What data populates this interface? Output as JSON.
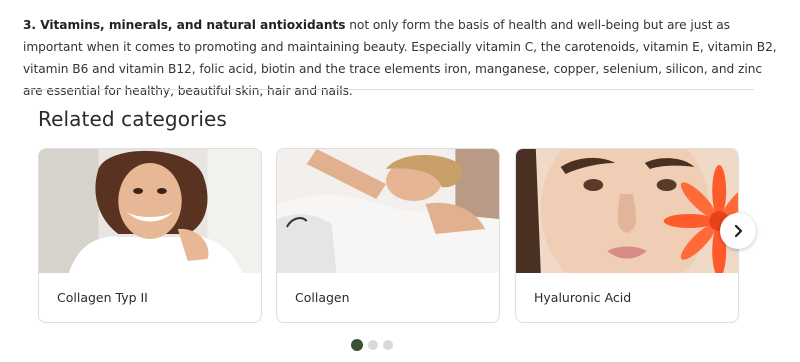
{
  "article": {
    "bold_lead": "3. Vitamins, minerals, and natural antioxidants",
    "body": " not only form the basis of health and well-being but are just as important when it comes to promoting and maintaining beauty. Especially vitamin C, the carotenoids, vitamin E, vitamin B2, vitamin B6 and vitamin B12, folic acid, biotin and the trace elements iron, manganese, copper, selenium, silicon, and zinc are essential for healthy, beautiful skin, hair and nails."
  },
  "related": {
    "title": "Related categories",
    "cards": [
      {
        "label": "Collagen Typ II",
        "image": "smiling-woman-photo"
      },
      {
        "label": "Collagen",
        "image": "relaxing-woman-photo"
      },
      {
        "label": "Hyaluronic Acid",
        "image": "woman-with-flower-photo"
      }
    ],
    "next_icon": "chevron-right-icon",
    "pagination": {
      "total": 3,
      "active": 1
    }
  },
  "colors": {
    "active_dot": "#3a5232",
    "inactive_dot": "#d9d9d9",
    "flower": "#ff5a2a"
  }
}
